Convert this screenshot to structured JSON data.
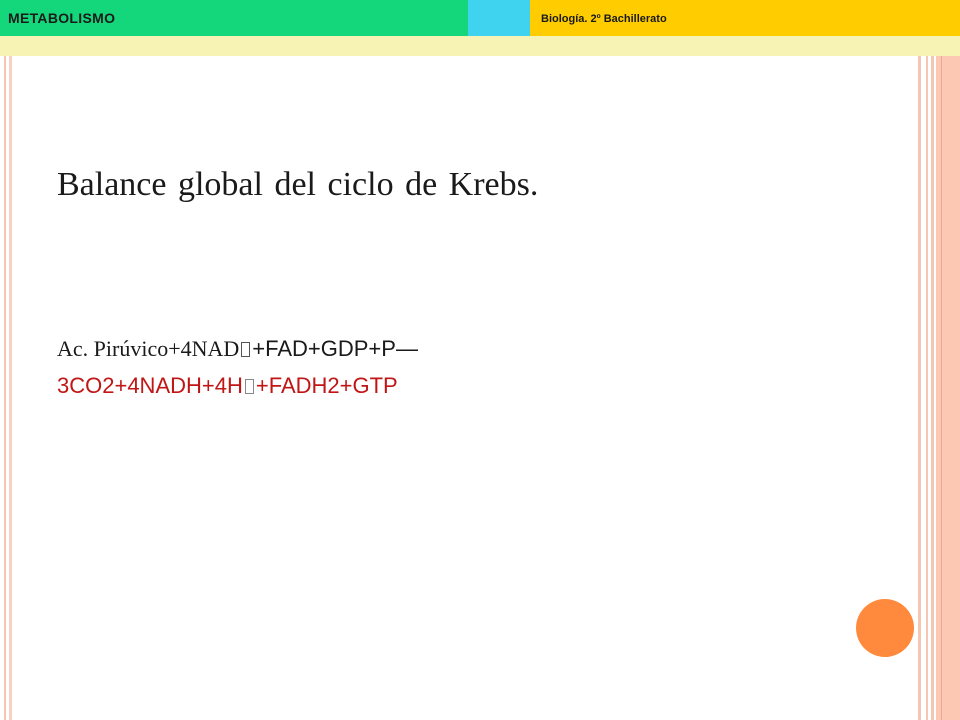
{
  "header": {
    "title": "METABOLISMO",
    "subtitle": "Biología. 2º Bachillerato"
  },
  "content": {
    "title": "Balance global del ciclo de Krebs.",
    "equation": {
      "line1_reactant": "Ac. Pirúvico+4NAD",
      "line1_rest": "+FAD+GDP+P",
      "line1_arrow": "—",
      "line2_part1": "3CO2+4NADH+4H",
      "line2_part2": "+FADH2+GTP"
    }
  },
  "colors": {
    "header_green": "#14d77c",
    "header_cyan": "#40d3f0",
    "header_yellow": "#ffcc00",
    "header_band": "#f7f3b4",
    "side_band": "#fcc7b3",
    "circle": "#ff8a3d",
    "product_text": "#c01616"
  }
}
